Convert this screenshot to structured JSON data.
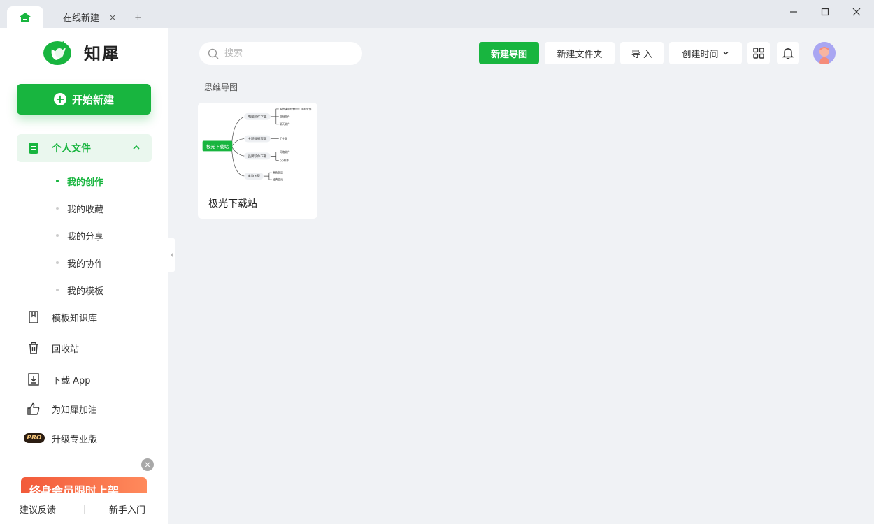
{
  "titlebar": {
    "tabs": [
      {
        "label": "在线新建",
        "close": "×"
      }
    ],
    "add_tab": "+"
  },
  "sidebar": {
    "brand": "知犀",
    "new_button": "开始新建",
    "personal_files": "个人文件",
    "sub_items": [
      "我的创作",
      "我的收藏",
      "我的分享",
      "我的协作",
      "我的模板"
    ],
    "nav": {
      "template_library": "模板知识库",
      "recycle_bin": "回收站",
      "download_app": "下载 App",
      "support": "为知犀加油",
      "upgrade": "升级专业版",
      "pro_badge": "PRO"
    },
    "promo_text": "终身会员限时上架",
    "promo_close": "×",
    "footer": {
      "feedback": "建议反馈",
      "beginner": "新手入门"
    }
  },
  "toolbar": {
    "search_placeholder": "搜索",
    "new_map": "新建导图",
    "new_folder": "新建文件夹",
    "import": "导 入",
    "sort": "创建时间"
  },
  "main": {
    "section_title": "思维导图",
    "cards": [
      {
        "name": "极光下载站",
        "thumb": {
          "root": "极光下载站",
          "branches": [
            {
              "label": "电脑软件下载",
              "leaves": [
                "系统辅助软件",
                "视频软件",
                "聊天软件"
              ],
              "extra": "手机软件"
            },
            {
              "label": "主题数据资源",
              "leaves": [
                "了主题"
              ]
            },
            {
              "label": "品牌软件下载",
              "leaves": [
                "网络软件",
                "QQ软件"
              ]
            },
            {
              "label": "手游下载",
              "leaves": [
                "角色扮演",
                "经典游戏"
              ]
            }
          ]
        }
      }
    ]
  },
  "colors": {
    "accent": "#18b53f",
    "background": "#f0f2f5"
  }
}
